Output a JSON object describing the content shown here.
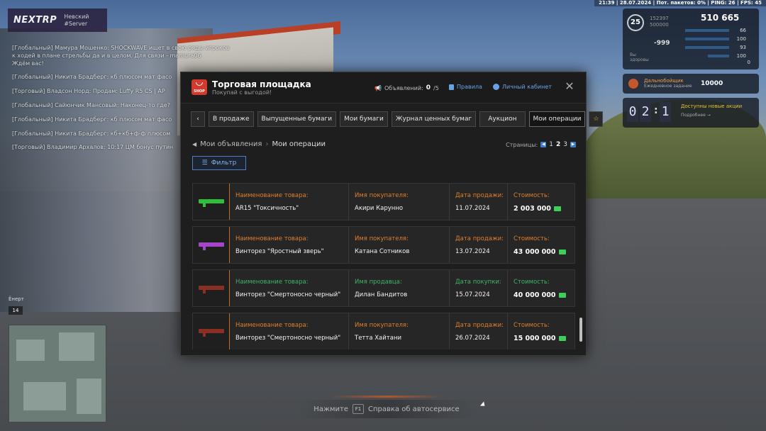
{
  "status_bar": "21:39 | 28.07.2024 | Пот. пакетов: 0% | PING: 26 | FPS: 45",
  "hud": {
    "logo": "NEXTRP",
    "server_name": "Невский",
    "server_sub": "#Server",
    "level": "25",
    "xp": "152397",
    "xp_max": "500000",
    "money": "510 665",
    "wanted": "-999",
    "stats": [
      "66",
      "100",
      "93",
      "0"
    ],
    "health_value": "100",
    "health_caption": "Вы здоровы",
    "mission_title": "Дальнобойщик",
    "mission_sub": "Ежедневное задание",
    "mission_reward": "10000",
    "timer_min": [
      "0",
      "2"
    ],
    "timer_sec": [
      "1",
      "9"
    ],
    "timer_title": "Доступны новые акции",
    "timer_link": "Подробнее →",
    "speed_label": "Ёнерт",
    "speed_value": "14"
  },
  "chat": [
    "[Глобальный] Мамура Мошенко: SHOCKWAVE ищет в свою ряды игроков",
    "к ходей в плане стрельбы да и в целом. Для связи - mamura06",
    "Ждём вас!",
    "[Глобальный] Никита Брадберг: кб плюсом мат фасо",
    "[Торговый] Владсон Норд: Продам: Luffy R5 CS | AP",
    "[Глобальный] Сайюнчик Мансовый: Наконец-то где?",
    "[Глобальный] Никита Брадберг: кб плюсом мат фасо",
    "[Глобальный] Никита Брадберг: кб+кб+ф-ф плюсом",
    "[Торговый] Владимир Архалов: 10:17 ЦМ бонус путин"
  ],
  "modal": {
    "title": "Торговая площадка",
    "subtitle": "Покупай с выгодой!",
    "shop_badge": "SHOP",
    "ads_label": "Объявлений:",
    "ads_count": "0",
    "ads_max": "/5",
    "rules": "Правила",
    "cabinet": "Личный кабинет",
    "tabs": [
      "В продаже",
      "Выпущенные бумаги",
      "Мои бумаги",
      "Журнал ценных бумаг",
      "Аукцион",
      "Мои операции"
    ],
    "active_tab": "Мои операции",
    "breadcrumb": [
      "Мои объявления",
      "Мои операции"
    ],
    "pages_label": "Страницы:",
    "pages": [
      "1",
      "2",
      "3"
    ],
    "current_page": "2",
    "filter": "Фильтр"
  },
  "operations": [
    {
      "item_label": "Наименование товара:",
      "item": "AR15 \"Токсичность\"",
      "party_label": "Имя покупателя:",
      "party": "Акири Карунно",
      "date_label": "Дата продажи:",
      "date": "11.07.2024",
      "price_label": "Стоимость:",
      "price": "2 003 000",
      "label_color": "orange",
      "gun_color": "#2fbf3a"
    },
    {
      "item_label": "Наименование товара:",
      "item": "Винторез \"Яростный зверь\"",
      "party_label": "Имя покупателя:",
      "party": "Катана Сотников",
      "date_label": "Дата продажи:",
      "date": "13.07.2024",
      "price_label": "Стоимость:",
      "price": "43 000 000",
      "label_color": "orange",
      "gun_color": "#a545c8"
    },
    {
      "item_label": "Наименование товара:",
      "item": "Винторез \"Смертоносно черный\"",
      "party_label": "Имя продавца:",
      "party": "Дилан Бандитов",
      "date_label": "Дата покупки:",
      "date": "15.07.2024",
      "price_label": "Стоимость:",
      "price": "40 000 000",
      "label_color": "green",
      "gun_color": "#8a2f24"
    },
    {
      "item_label": "Наименование товара:",
      "item": "Винторез \"Смертоносно черный\"",
      "party_label": "Имя покупателя:",
      "party": "Тетта Хайтани",
      "date_label": "Дата продажи:",
      "date": "26.07.2024",
      "price_label": "Стоимость:",
      "price": "15 000 000",
      "label_color": "orange",
      "gun_color": "#8a2f24"
    }
  ],
  "hint": {
    "prefix": "Нажмите",
    "key": "F1",
    "text": "Справка об автосервисе"
  }
}
